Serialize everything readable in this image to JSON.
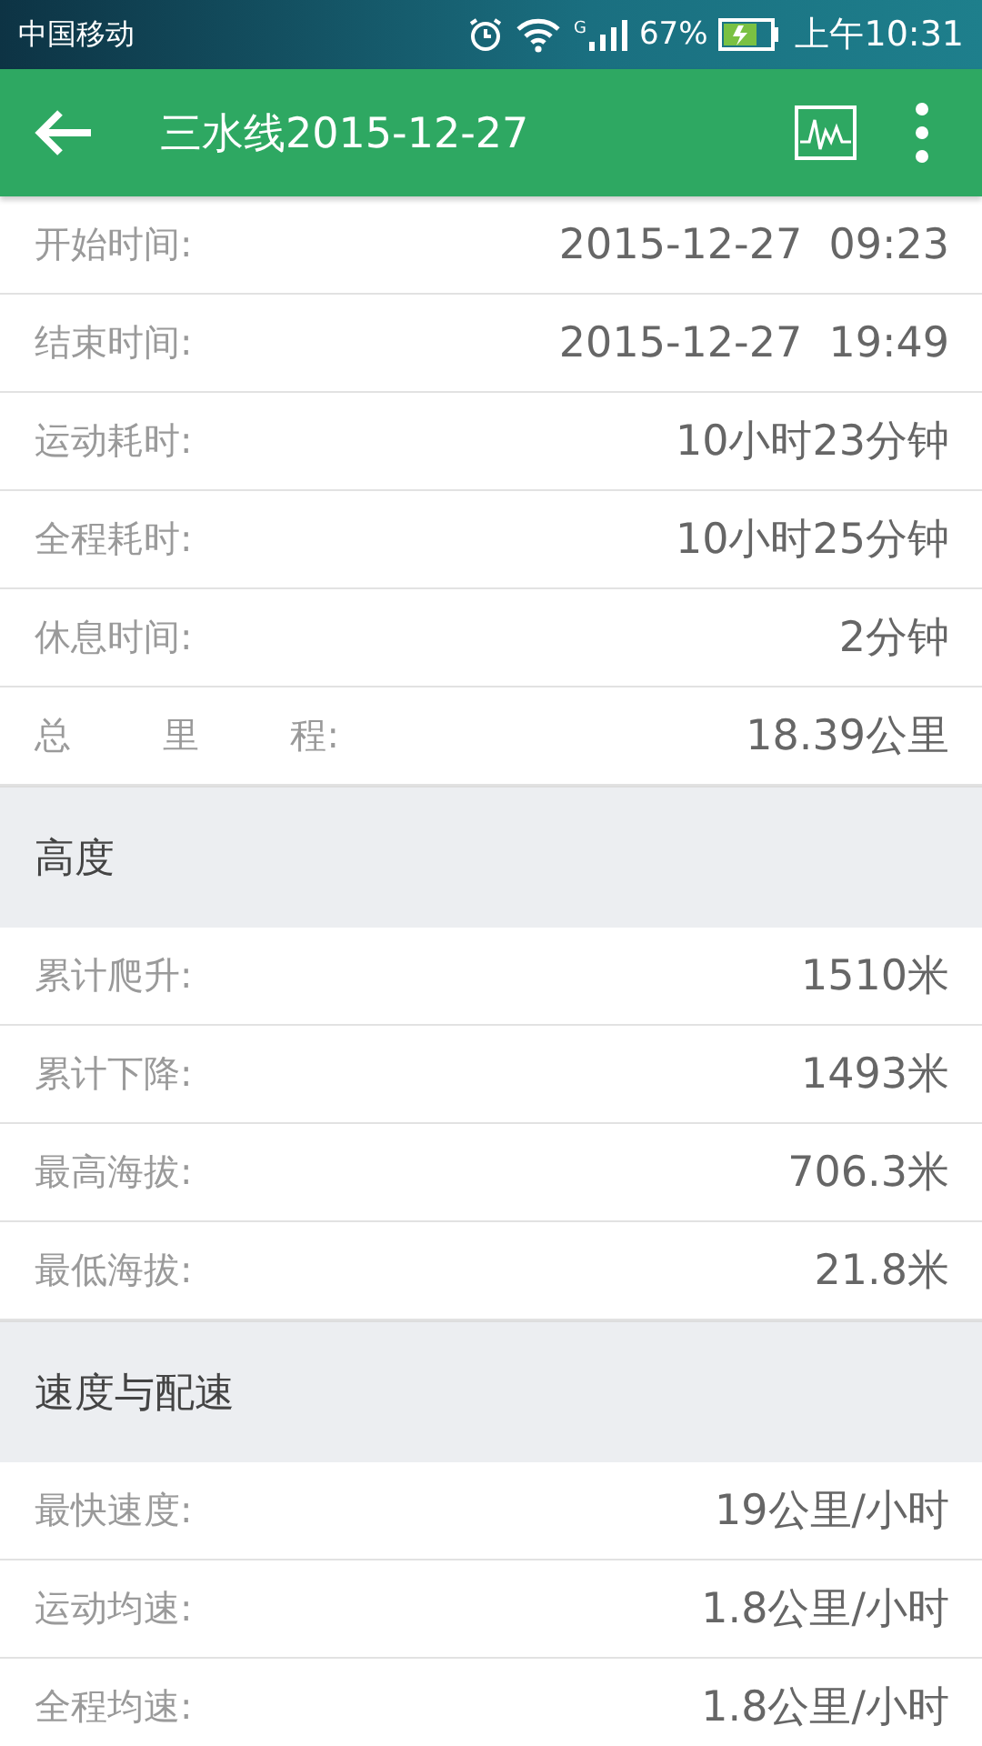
{
  "status_bar": {
    "carrier": "中国移动",
    "network": "G",
    "battery": "67%",
    "time": "上午10:31"
  },
  "header": {
    "title": "三水线2015-12-27"
  },
  "sections": [
    {
      "rows": [
        {
          "label": "开始时间:",
          "value": "2015-12-27  09:23"
        },
        {
          "label": "结束时间:",
          "value": "2015-12-27  19:49"
        },
        {
          "label": "运动耗时:",
          "value": "10小时23分钟"
        },
        {
          "label": "全程耗时:",
          "value": "10小时25分钟"
        },
        {
          "label": "休息时间:",
          "value": "2分钟"
        },
        {
          "label": "总 里 程:",
          "value": "18.39公里"
        }
      ]
    },
    {
      "heading": "高度",
      "rows": [
        {
          "label": "累计爬升:",
          "value": "1510米"
        },
        {
          "label": "累计下降:",
          "value": "1493米"
        },
        {
          "label": "最高海拔:",
          "value": "706.3米"
        },
        {
          "label": "最低海拔:",
          "value": "21.8米"
        }
      ]
    },
    {
      "heading": "速度与配速",
      "rows": [
        {
          "label": "最快速度:",
          "value": "19公里/小时"
        },
        {
          "label": "运动均速:",
          "value": "1.8公里/小时"
        },
        {
          "label": "全程均速:",
          "value": "1.8公里/小时"
        }
      ]
    }
  ]
}
